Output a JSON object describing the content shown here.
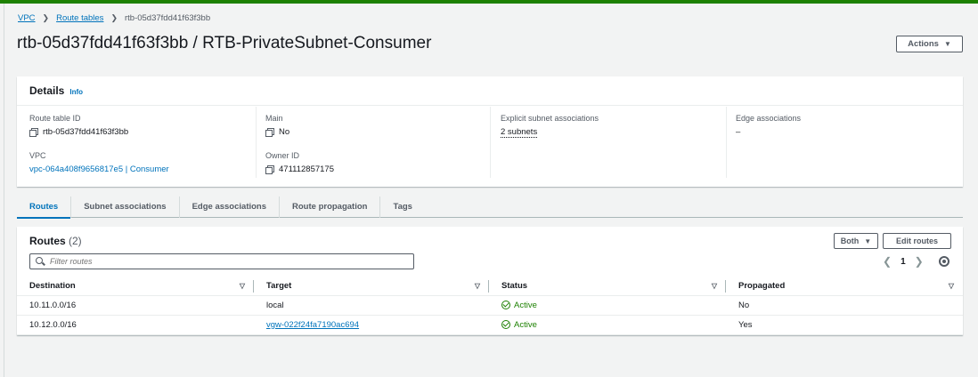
{
  "breadcrumb": {
    "vpc": "VPC",
    "route_tables": "Route tables",
    "current": "rtb-05d37fdd41f63f3bb"
  },
  "page_title": "rtb-05d37fdd41f63f3bb / RTB-PrivateSubnet-Consumer",
  "actions_label": "Actions",
  "details": {
    "title": "Details",
    "info": "Info",
    "route_table_id": {
      "label": "Route table ID",
      "value": "rtb-05d37fdd41f63f3bb"
    },
    "main": {
      "label": "Main",
      "value": "No"
    },
    "explicit": {
      "label": "Explicit subnet associations",
      "value": "2 subnets"
    },
    "edge": {
      "label": "Edge associations",
      "value": "–"
    },
    "vpc": {
      "label": "VPC",
      "value": "vpc-064a408f9656817e5 | Consumer"
    },
    "owner": {
      "label": "Owner ID",
      "value": "471112857175"
    }
  },
  "tabs": [
    "Routes",
    "Subnet associations",
    "Edge associations",
    "Route propagation",
    "Tags"
  ],
  "routes": {
    "title": "Routes",
    "count": "(2)",
    "both_label": "Both",
    "edit_label": "Edit routes",
    "filter_placeholder": "Filter routes",
    "page": "1",
    "columns": [
      "Destination",
      "Target",
      "Status",
      "Propagated"
    ],
    "rows": [
      {
        "destination": "10.11.0.0/16",
        "target": "local",
        "status": "Active",
        "propagated": "No"
      },
      {
        "destination": "10.12.0.0/16",
        "target": "vgw-022f24fa7190ac694",
        "status": "Active",
        "propagated": "Yes"
      }
    ]
  },
  "colors": {
    "accent": "#0073bb",
    "success": "#1d8102",
    "topbar": "#1d8102"
  },
  "icons": [
    "chevron-right-icon",
    "caret-down-icon",
    "copy-icon",
    "search-icon",
    "chevron-left-icon",
    "gear-icon",
    "check-circle-icon",
    "sort-icon"
  ]
}
